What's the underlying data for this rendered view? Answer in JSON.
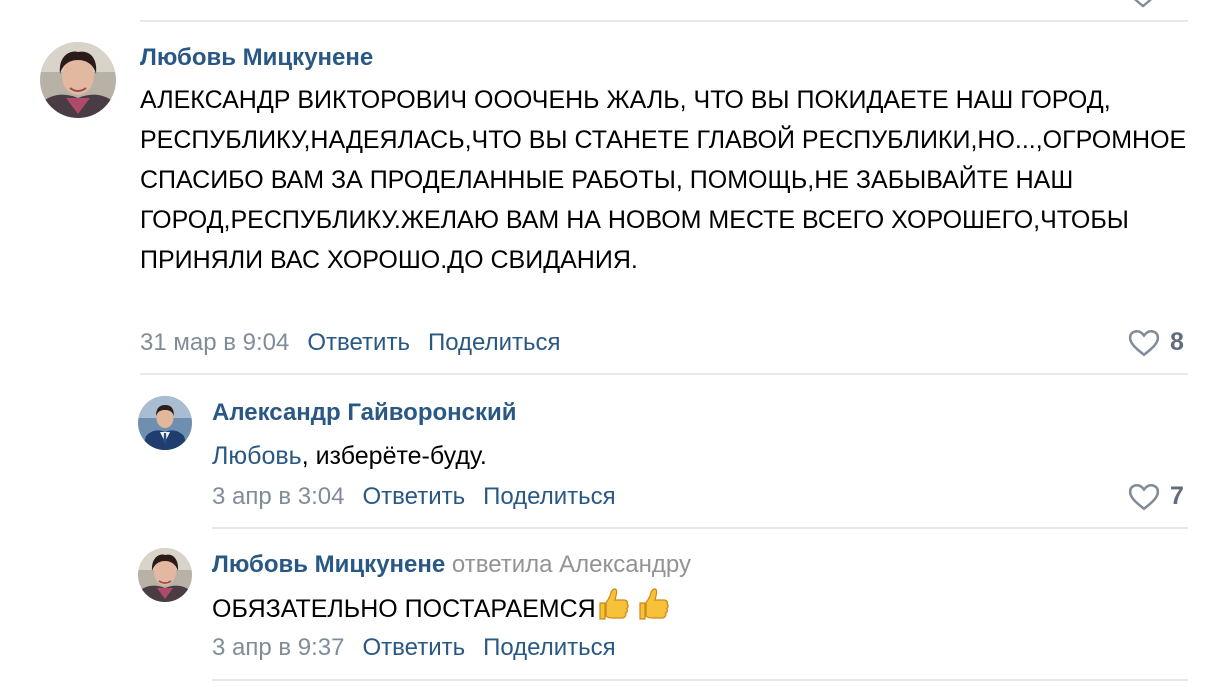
{
  "comments": [
    {
      "author": "Любовь Мицкунене",
      "text": "АЛЕКСАНДР ВИКТОРОВИЧ ОООЧЕНЬ ЖАЛЬ, ЧТО ВЫ ПОКИДАЕТЕ НАШ ГОРОД, РЕСПУБЛИКУ,НАДЕЯЛАСЬ,ЧТО ВЫ СТАНЕТЕ ГЛАВОЙ РЕСПУБЛИКИ,НО...,ОГРОМНОЕ СПАСИБО ВАМ ЗА ПРОДЕЛАННЫЕ РАБОТЫ, ПОМОЩЬ,НЕ ЗАБЫВАЙТЕ НАШ ГОРОД,РЕСПУБЛИКУ.ЖЕЛАЮ ВАМ НА НОВОМ МЕСТЕ ВСЕГО ХОРОШЕГО,ЧТОБЫ ПРИНЯЛИ ВАС ХОРОШО.ДО СВИДАНИЯ.",
      "date": "31 мар в 9:04",
      "reply_label": "Ответить",
      "share_label": "Поделиться",
      "likes": "8"
    },
    {
      "author": "Александр Гайворонский",
      "mention": "Любовь",
      "text": ", изберёте-буду.",
      "date": "3 апр в 3:04",
      "reply_label": "Ответить",
      "share_label": "Поделиться",
      "likes": "7"
    },
    {
      "author": "Любовь Мицкунене",
      "replied_to": "ответила Александру",
      "text": "ОБЯЗАТЕЛЬНО ПОСТАРАЕМСЯ",
      "emoji": "thumbs-up-emoji",
      "date": "3 апр в 9:37",
      "reply_label": "Ответить",
      "share_label": "Поделиться"
    }
  ],
  "colors": {
    "link": "#2a5885",
    "meta": "#818c99",
    "divider": "#e7e8ec",
    "like_count": "#626d7a"
  }
}
